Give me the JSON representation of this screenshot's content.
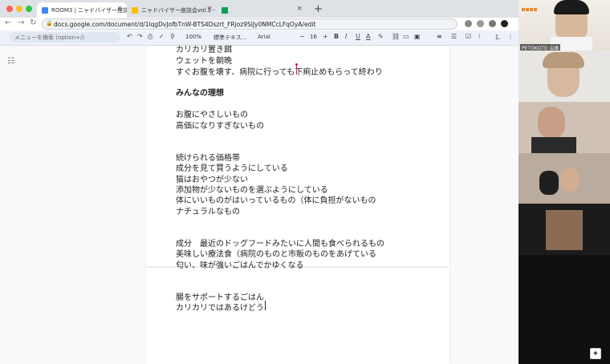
{
  "browser": {
    "tabs": [
      {
        "title": "ROOM3 | ニャドバイザー座談会…",
        "active": true
      },
      {
        "title": "ニャドバイザー座談会vol.1 - Goo…",
        "active": false
      },
      {
        "title": "",
        "active": false
      }
    ],
    "url": "docs.google.com/document/d/1lqgDvJofbTnW-BTS4Dszrt_FRjoz9SlJy0NMCcLFqOyA/edit"
  },
  "toolbar": {
    "menu_search_placeholder": "メニューを検索 (option+/)",
    "zoom": "100%",
    "style": "標準テキス…",
    "font": "Arial",
    "font_size": "16"
  },
  "document": {
    "lines": [
      {
        "text": "カリカリ置き餌",
        "bold": false
      },
      {
        "text": "ウェットを朝晩",
        "bold": false
      },
      {
        "text": "すぐお腹を壊す、病院に行っても下痢止めもらって終わり",
        "bold": false
      },
      {
        "text": "みんなの理想",
        "bold": true
      },
      {
        "text": "お腹にやさしいもの",
        "bold": false
      },
      {
        "text": "高価になりすぎないもの",
        "bold": false
      },
      {
        "text": "続けられる価格帯",
        "bold": false
      },
      {
        "text": "成分を見て買うようにしている",
        "bold": false
      },
      {
        "text": "猫はおやつが少ない",
        "bold": false
      },
      {
        "text": "添加物が少ないものを選ぶようにしている",
        "bold": false
      },
      {
        "text": "体にいいものがはいっているもの（体に負担がないもの",
        "bold": false
      },
      {
        "text": "ナチュラルなもの",
        "bold": false
      },
      {
        "text": "成分　最近のドッグフードみたいに人間も食べられるもの",
        "bold": false
      },
      {
        "text": "美味しい療法食（病院のものと市販のものをあげている",
        "bold": false
      },
      {
        "text": "匂い、味が強いごはんでかゆくなる",
        "bold": false
      },
      {
        "text": "腸をサポートするごはん",
        "bold": false
      },
      {
        "text": "カリカリではあるけどう",
        "bold": false
      }
    ]
  },
  "zoom_panel": {
    "participants": [
      {
        "name": "PETOKOTO 山本"
      },
      {
        "name": ""
      },
      {
        "name": ""
      },
      {
        "name": ""
      },
      {
        "name": ""
      }
    ]
  },
  "colors": {
    "chrome_bg": "#dee1e6",
    "docs_toolbar": "#edf2fa",
    "accent_cursor": "#d4145a",
    "zoom_bg": "#0f0f0f"
  }
}
